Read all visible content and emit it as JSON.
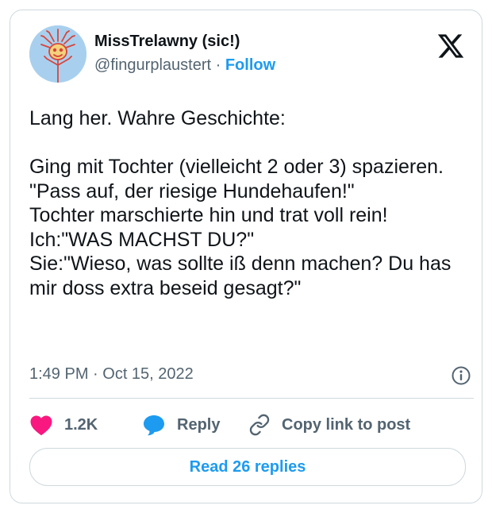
{
  "author": {
    "display_name": "MissTrelawny (sic!)",
    "handle": "@fingurplaustert",
    "separator": " · ",
    "follow_label": "Follow",
    "avatar_icon": "stick-figure-drawing-avatar"
  },
  "brand": {
    "logo_icon": "x-logo"
  },
  "tweet": {
    "lines": [
      "Lang her. Wahre Geschichte:",
      "",
      "Ging mit Tochter (vielleicht 2 oder 3) spazieren.",
      "\"Pass auf, der riesige Hundehaufen!\"",
      "Tochter marschierte hin und trat voll rein!",
      "Ich:\"WAS MACHST DU?\"",
      "Sie:\"Wieso, was sollte iß denn machen? Du has mir doss extra beseid gesagt?\""
    ],
    "timestamp": "1:49 PM · Oct 15, 2022"
  },
  "actions": {
    "like_count": "1.2K",
    "reply_label": "Reply",
    "copy_label": "Copy link to post"
  },
  "footer": {
    "read_replies_label": "Read 26 replies"
  },
  "colors": {
    "accent": "#1d9bf0",
    "like_heart": "#f91880",
    "secondary_text": "#536471",
    "border": "#cfd9de"
  }
}
